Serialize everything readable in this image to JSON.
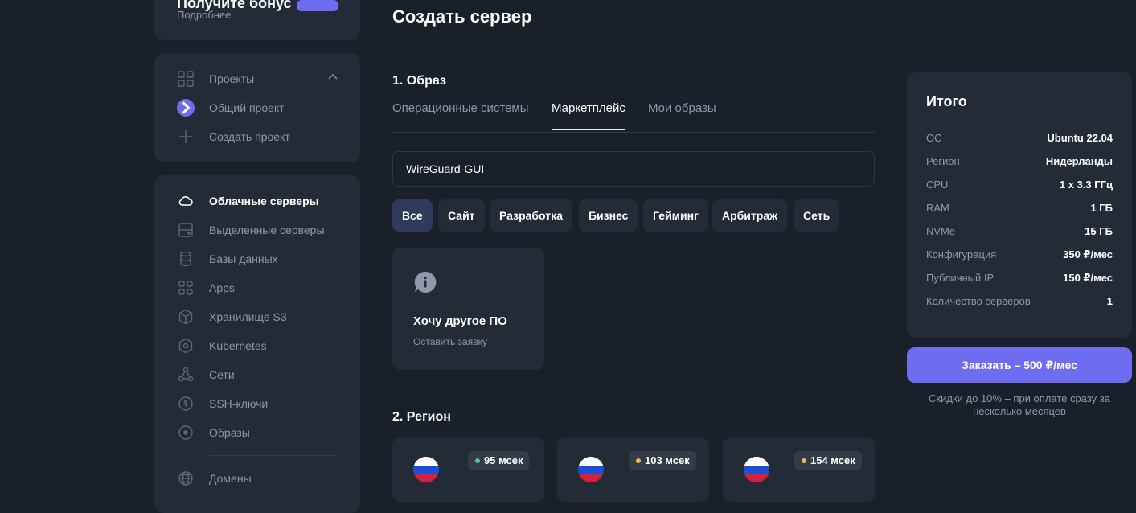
{
  "promo": {
    "title": "Получите бонус",
    "link": "Подробнее"
  },
  "projects": {
    "header": "Проекты",
    "items": [
      {
        "label": "Общий проект"
      },
      {
        "label": "Создать проект"
      }
    ]
  },
  "nav": {
    "items": [
      {
        "label": "Облачные серверы",
        "icon": "cloud-icon"
      },
      {
        "label": "Выделенные серверы",
        "icon": "server-icon"
      },
      {
        "label": "Базы данных",
        "icon": "database-icon"
      },
      {
        "label": "Apps",
        "icon": "apps-icon"
      },
      {
        "label": "Хранилище S3",
        "icon": "cube-icon"
      },
      {
        "label": "Kubernetes",
        "icon": "kubernetes-icon"
      },
      {
        "label": "Сети",
        "icon": "network-icon"
      },
      {
        "label": "SSH-ключи",
        "icon": "key-icon"
      },
      {
        "label": "Образы",
        "icon": "disc-icon"
      },
      {
        "label": "Домены",
        "icon": "globe-icon"
      }
    ]
  },
  "main": {
    "title": "Создать сервер",
    "section1": "1. Образ",
    "tabs": [
      {
        "label": "Операционные системы"
      },
      {
        "label": "Маркетплейс"
      },
      {
        "label": "Мои образы"
      }
    ],
    "search": {
      "value": "WireGuard-GUI"
    },
    "filters": [
      "Все",
      "Сайт",
      "Разработка",
      "Бизнес",
      "Гейминг",
      "Арбитраж",
      "Сеть"
    ],
    "tile": {
      "title": "Хочу другое ПО",
      "link": "Оставить заявку"
    },
    "section2": "2. Регион",
    "regions": [
      {
        "ping": "95 мсек",
        "ping_color": "#4fc98a"
      },
      {
        "ping": "103 мсек",
        "ping_color": "#f2b84b"
      },
      {
        "ping": "154 мсек",
        "ping_color": "#f2b84b"
      }
    ]
  },
  "summary": {
    "title": "Итого",
    "rows": [
      {
        "key": "ОС",
        "value": "Ubuntu 22.04"
      },
      {
        "key": "Регион",
        "value": "Нидерланды"
      },
      {
        "key": "CPU",
        "value": "1 x 3.3 ГГц"
      },
      {
        "key": "RAM",
        "value": "1 ГБ"
      },
      {
        "key": "NVMe",
        "value": "15 ГБ"
      },
      {
        "key": "Конфигурация",
        "value": "350 ₽/мес"
      },
      {
        "key": "Публичный IP",
        "value": "150 ₽/мес"
      },
      {
        "key": "Количество серверов",
        "value": "1"
      }
    ],
    "order_label": "Заказать – 500 ₽/мес",
    "note": "Скидки до 10% – при оплате сразу за несколько месяцев"
  },
  "colors": {
    "accent": "#6e6cf0",
    "background": "#1a202a",
    "card": "#232b37"
  }
}
